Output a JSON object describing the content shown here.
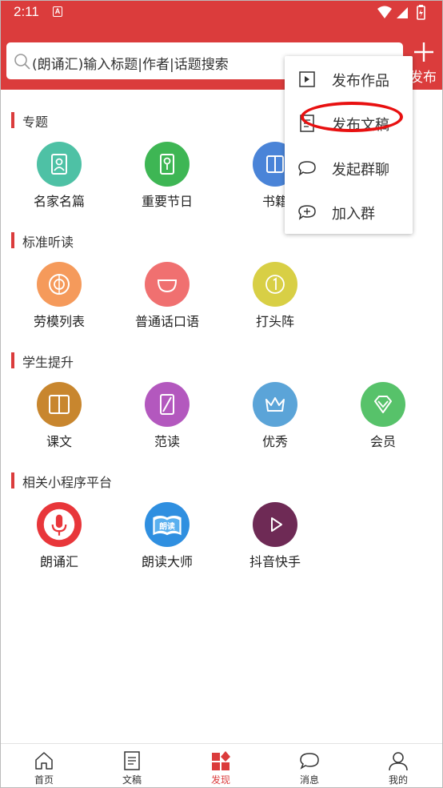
{
  "status": {
    "time": "2:11",
    "notification_badge": "A"
  },
  "header": {
    "search_placeholder": "(朗诵汇)输入标题|作者|话题搜索",
    "publish_label": "发布",
    "accent_color": "#db3c3c"
  },
  "sections": [
    {
      "title": "专题",
      "items": [
        {
          "label": "名家名篇",
          "icon": "portrait-icon",
          "color": "#4ec1a5"
        },
        {
          "label": "重要节日",
          "icon": "lantern-icon",
          "color": "#3eb654"
        },
        {
          "label": "书籍",
          "icon": "book-icon",
          "color": "#4a84d8"
        }
      ]
    },
    {
      "title": "标准听读",
      "items": [
        {
          "label": "劳模列表",
          "icon": "medal-icon",
          "color": "#f59a5b"
        },
        {
          "label": "普通话口语",
          "icon": "bowl-icon",
          "color": "#f07070"
        },
        {
          "label": "打头阵",
          "icon": "number-one-icon",
          "color": "#d8cf45"
        }
      ]
    },
    {
      "title": "学生提升",
      "items": [
        {
          "label": "课文",
          "icon": "open-book-icon",
          "color": "#c8862e"
        },
        {
          "label": "范读",
          "icon": "slash-card-icon",
          "color": "#b358be"
        },
        {
          "label": "优秀",
          "icon": "crown-icon",
          "color": "#5ba4d8"
        },
        {
          "label": "会员",
          "icon": "diamond-icon",
          "color": "#57c26a"
        }
      ]
    },
    {
      "title": "相关小程序平台",
      "items": [
        {
          "label": "朗诵汇",
          "icon": "microphone-icon",
          "color": "#ffffff"
        },
        {
          "label": "朗读大师",
          "icon": "reading-book-icon",
          "color": "#2f8fe0",
          "badge_text": "朗读"
        },
        {
          "label": "抖音快手",
          "icon": "play-icon",
          "color": "#6e2a55"
        }
      ]
    }
  ],
  "menu": {
    "items": [
      {
        "label": "发布作品",
        "icon": "play-doc-icon"
      },
      {
        "label": "发布文稿",
        "icon": "document-icon"
      },
      {
        "label": "发起群聊",
        "icon": "chat-bubble-icon"
      },
      {
        "label": "加入群",
        "icon": "add-group-icon"
      }
    ],
    "highlighted": "发布文稿"
  },
  "tabs": [
    {
      "label": "首页",
      "icon": "home-icon"
    },
    {
      "label": "文稿",
      "icon": "document-icon"
    },
    {
      "label": "发现",
      "icon": "discover-icon",
      "active": true
    },
    {
      "label": "消息",
      "icon": "chat-bubble-icon"
    },
    {
      "label": "我的",
      "icon": "person-icon"
    }
  ]
}
